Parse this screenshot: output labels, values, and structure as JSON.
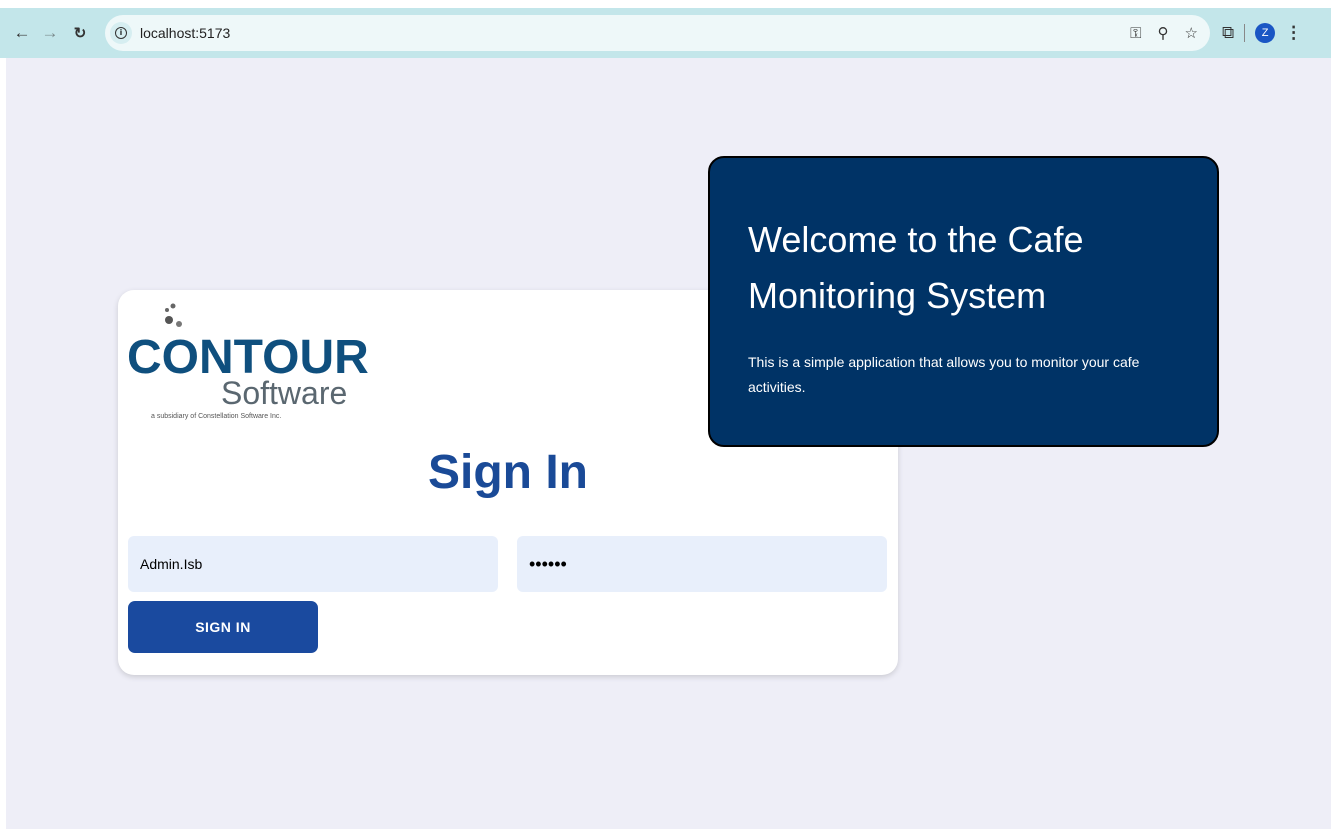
{
  "browser": {
    "url": "localhost:5173",
    "profile_initial": "Z"
  },
  "logo": {
    "brand": "CONTOUR",
    "sub": "Software",
    "tagline": "a subsidiary of Constellation Software Inc."
  },
  "signin": {
    "title": "Sign In",
    "username_value": "Admin.Isb",
    "password_value": "••••••",
    "button_label": "SIGN IN"
  },
  "welcome": {
    "title": "Welcome to the Cafe Monitoring System",
    "description": "This is a simple application that allows you to monitor your cafe activities."
  },
  "colors": {
    "accent": "#1a4a9f",
    "panel": "#003366",
    "page_bg": "#eeeef7"
  }
}
